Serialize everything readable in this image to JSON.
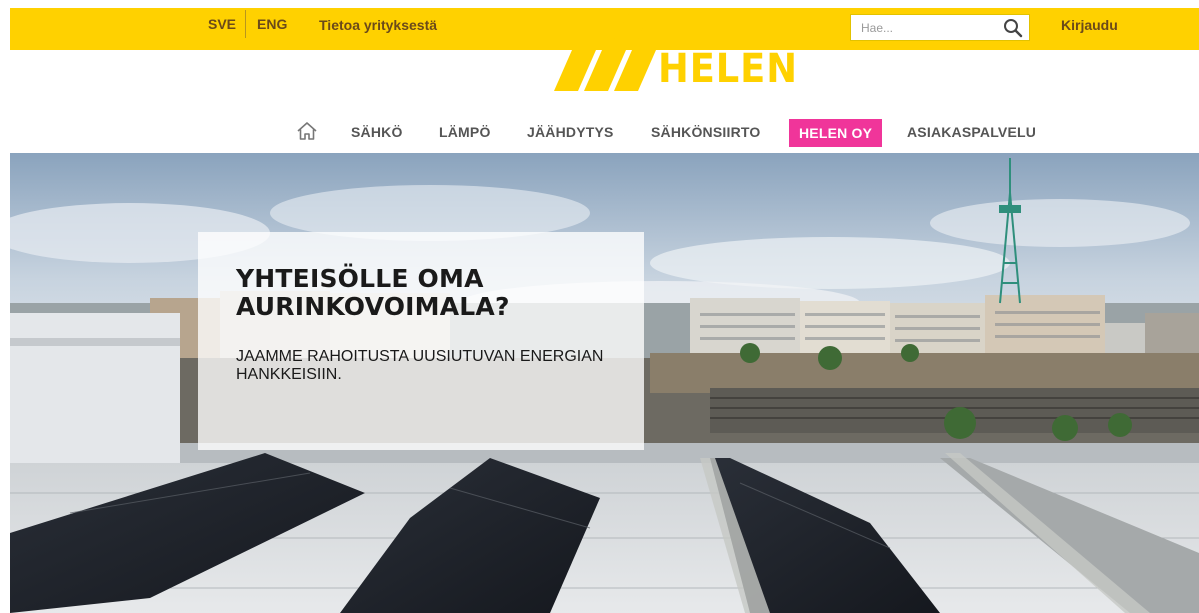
{
  "header": {
    "languages": [
      "SVE",
      "ENG"
    ],
    "about_label": "Tietoa yrityksestä",
    "search_placeholder": "Hae...",
    "login_label": "Kirjaudu",
    "brand_name": "HELEN",
    "brand_color": "#ffd100"
  },
  "nav": {
    "home_icon": "home-icon",
    "items": [
      {
        "label": "SÄHKÖ"
      },
      {
        "label": "LÄMPÖ"
      },
      {
        "label": "JÄÄHDYTYS"
      },
      {
        "label": "SÄHKÖNSIIRTO"
      },
      {
        "label": "HELEN OY",
        "active": true
      },
      {
        "label": "ASIAKASPALVELU"
      }
    ],
    "active_color": "#f0359a"
  },
  "hero": {
    "title": "YHTEISÖLLE OMA AURINKOVOIMALA?",
    "subtitle": "JAAMME RAHOITUSTA UUSIUTUVAN ENERGIAN HANKKEISIIN."
  }
}
